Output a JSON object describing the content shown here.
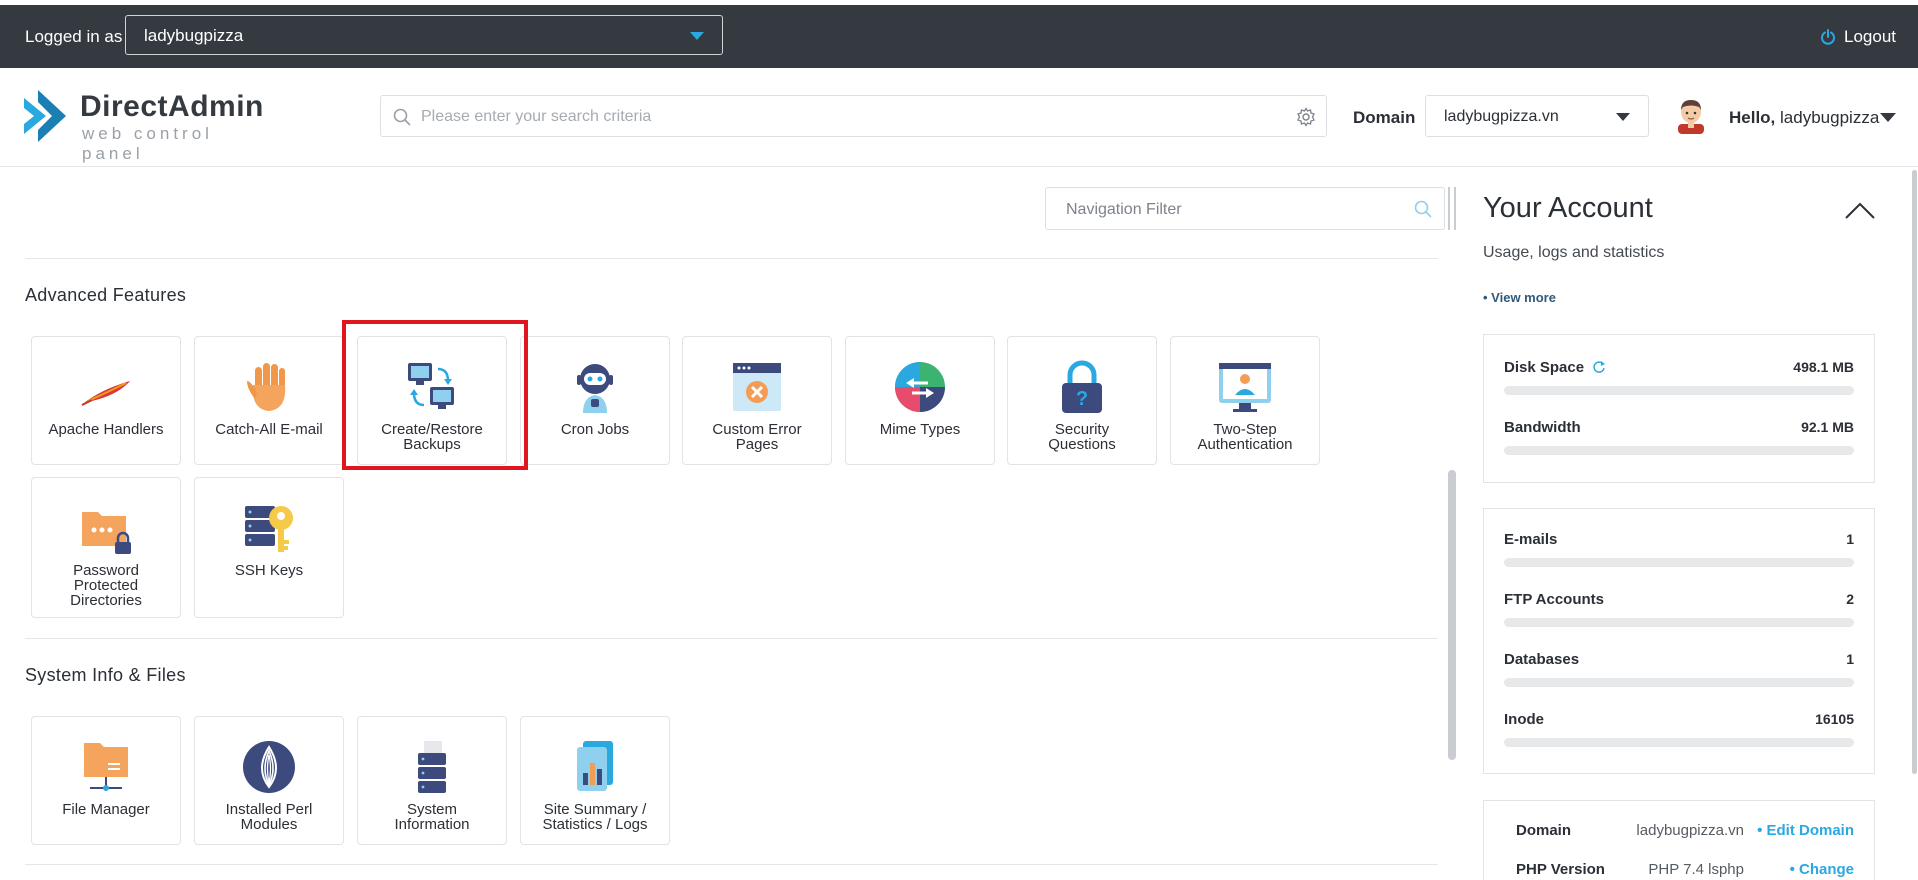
{
  "topbar": {
    "logged_in_label": "Logged in as",
    "user_value": "ladybugpizza",
    "logout_label": "Logout"
  },
  "header": {
    "logo_name": "DirectAdmin",
    "logo_tagline": "web control panel",
    "search_placeholder": "Please enter your search criteria",
    "domain_label": "Domain",
    "domain_value": "ladybugpizza.vn",
    "hello_bold": "Hello,",
    "hello_user": "ladybugpizza"
  },
  "main": {
    "nav_filter_placeholder": "Navigation Filter",
    "sections": [
      {
        "title": "Advanced Features",
        "tiles": [
          {
            "label_1": "Apache Handlers",
            "label_2": "",
            "label_3": "",
            "icon": "feather-icon"
          },
          {
            "label_1": "Catch-All E-mail",
            "label_2": "",
            "label_3": "",
            "icon": "glove-icon"
          },
          {
            "label_1": "Create/Restore",
            "label_2": "Backups",
            "label_3": "",
            "icon": "backup-icon"
          },
          {
            "label_1": "Cron Jobs",
            "label_2": "",
            "label_3": "",
            "icon": "robot-icon"
          },
          {
            "label_1": "Custom Error",
            "label_2": "Pages",
            "label_3": "",
            "icon": "error-page-icon"
          },
          {
            "label_1": "Mime Types",
            "label_2": "",
            "label_3": "",
            "icon": "mime-icon"
          },
          {
            "label_1": "Security",
            "label_2": "Questions",
            "label_3": "",
            "icon": "lock-question-icon"
          },
          {
            "label_1": "Two-Step",
            "label_2": "Authentication",
            "label_3": "",
            "icon": "two-step-icon"
          },
          {
            "label_1": "Password",
            "label_2": "Protected",
            "label_3": "Directories",
            "icon": "folder-lock-icon"
          },
          {
            "label_1": "SSH Keys",
            "label_2": "",
            "label_3": "",
            "icon": "ssh-key-icon"
          }
        ]
      },
      {
        "title": "System Info & Files",
        "tiles": [
          {
            "label_1": "File Manager",
            "label_2": "",
            "label_3": "",
            "icon": "folder-network-icon"
          },
          {
            "label_1": "Installed Perl",
            "label_2": "Modules",
            "label_3": "",
            "icon": "onion-icon"
          },
          {
            "label_1": "System",
            "label_2": "Information",
            "label_3": "",
            "icon": "server-icon"
          },
          {
            "label_1": "Site Summary /",
            "label_2": "Statistics / Logs",
            "label_3": "",
            "icon": "stats-icon"
          }
        ]
      }
    ]
  },
  "account": {
    "title": "Your Account",
    "subtitle": "Usage, logs and statistics",
    "view_more": "• View more",
    "usage": [
      {
        "label": "Disk Space",
        "value": "498.1 MB"
      },
      {
        "label": "Bandwidth",
        "value": "92.1 MB"
      }
    ],
    "counts": [
      {
        "label": "E-mails",
        "value": "1"
      },
      {
        "label": "FTP Accounts",
        "value": "2"
      },
      {
        "label": "Databases",
        "value": "1"
      },
      {
        "label": "Inode",
        "value": "16105"
      }
    ],
    "domain_info": [
      {
        "label": "Domain",
        "value": "ladybugpizza.vn",
        "action": "• Edit Domain"
      },
      {
        "label": "PHP Version",
        "value": "PHP 7.4 lsphp",
        "action": "• Change"
      }
    ]
  },
  "colors": {
    "topbar": "#353a41",
    "accent": "#2aa8e0",
    "highlight": "#e0161e"
  }
}
